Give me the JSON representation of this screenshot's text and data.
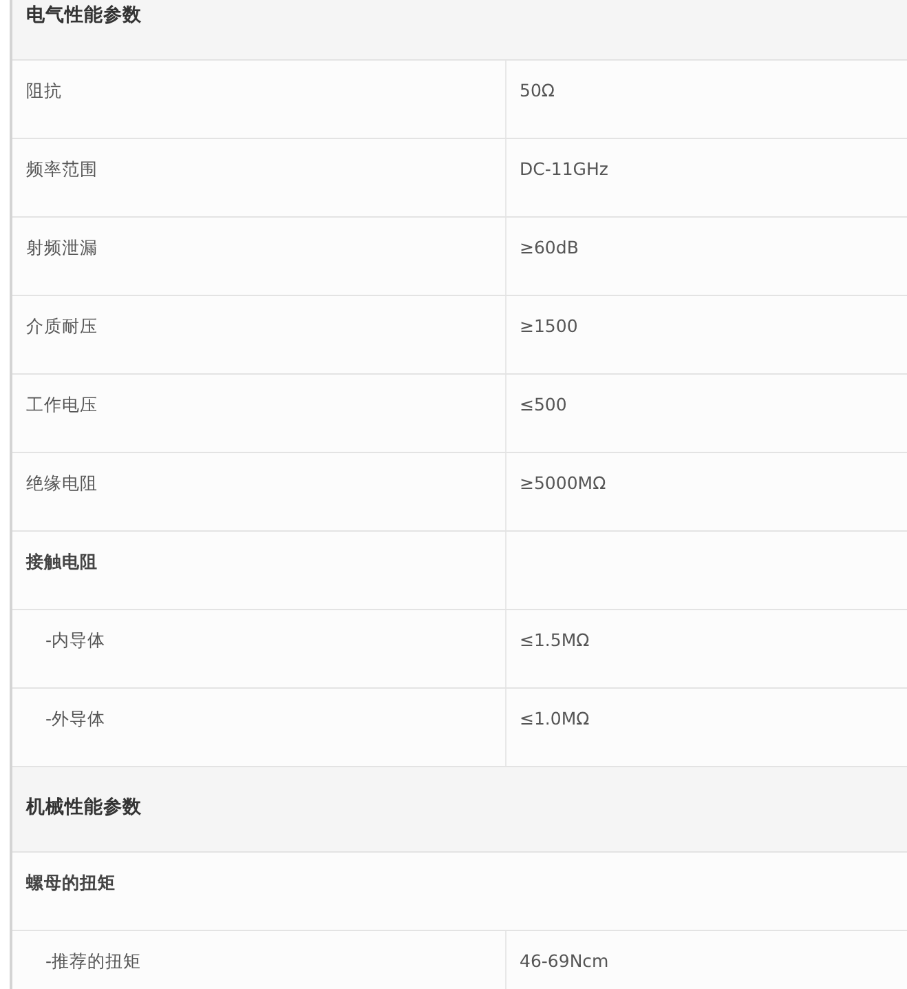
{
  "rows": [
    {
      "kind": "section",
      "label": "电气性能参数"
    },
    {
      "kind": "param",
      "label": "阻抗",
      "value": "50Ω"
    },
    {
      "kind": "param",
      "label": "频率范围",
      "value": "DC-11GHz"
    },
    {
      "kind": "param",
      "label": "射频泄漏",
      "value": "≥60dB"
    },
    {
      "kind": "param",
      "label": "介质耐压",
      "value": "≥1500"
    },
    {
      "kind": "param",
      "label": "工作电压",
      "value": "≤500"
    },
    {
      "kind": "param",
      "label": "绝缘电阻",
      "value": "≥5000MΩ"
    },
    {
      "kind": "group",
      "label": "接触电阻"
    },
    {
      "kind": "sub",
      "label": "-内导体",
      "value": "≤1.5MΩ"
    },
    {
      "kind": "sub",
      "label": "-外导体",
      "value": "≤1.0MΩ"
    },
    {
      "kind": "section",
      "label": "机械性能参数"
    },
    {
      "kind": "group-span",
      "label": "螺母的扭矩"
    },
    {
      "kind": "sub",
      "label": "-推荐的扭矩",
      "value": "46-69Ncm"
    }
  ]
}
